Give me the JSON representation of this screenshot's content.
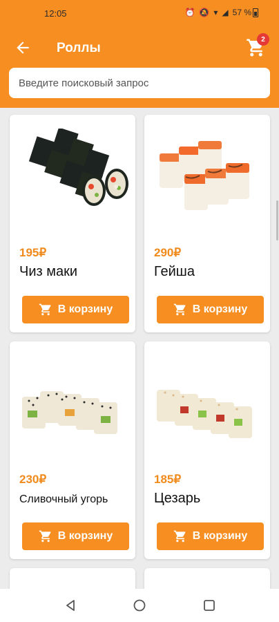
{
  "status": {
    "time": "12:05",
    "battery": "57 %"
  },
  "header": {
    "title": "Роллы",
    "cart_count": "2"
  },
  "search": {
    "placeholder": "Введите поисковый запрос",
    "value": ""
  },
  "products": [
    {
      "price": "195₽",
      "name": "Чиз маки",
      "button": "В корзину"
    },
    {
      "price": "290₽",
      "name": "Гейша",
      "button": "В корзину"
    },
    {
      "price": "230₽",
      "name": "Сливочный угорь",
      "button": "В корзину"
    },
    {
      "price": "185₽",
      "name": "Цезарь",
      "button": "В корзину"
    }
  ],
  "colors": {
    "accent": "#f68e21",
    "badge": "#e53935"
  },
  "icons": [
    "arrow-back-icon",
    "cart-icon",
    "nav-back-icon",
    "nav-home-icon",
    "nav-recent-icon"
  ]
}
